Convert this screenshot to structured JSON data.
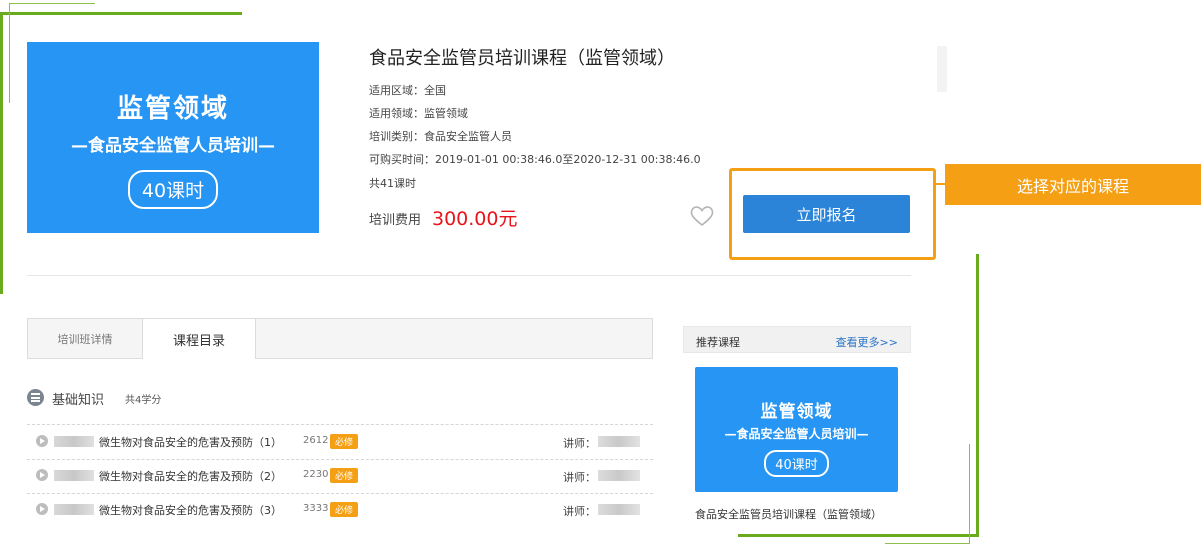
{
  "course": {
    "banner": {
      "title": "监管领域",
      "subtitle": "—食品安全监管人员培训—",
      "hours": "40课时"
    },
    "title": "食品安全监管员培训课程（监管领域）",
    "region": "适用区域：全国",
    "field": "适用领域：监管领域",
    "category": "培训类别：食品安全监管人员",
    "purchase_time": "可购买时间：2019-01-01 00:38:46.0至2020-12-31 00:38:46.0",
    "total_hours": "共41课时",
    "fee_label": "培训费用",
    "fee_value": "300.00元",
    "enroll_label": "立即报名"
  },
  "callout": {
    "text": "选择对应的课程",
    "color": "#f5a014"
  },
  "tabs": [
    {
      "label": "培训班详情",
      "active": false
    },
    {
      "label": "课程目录",
      "active": true
    }
  ],
  "section": {
    "icon": "list-icon",
    "title": "基础知识",
    "credit": "共4学分"
  },
  "lessons": [
    {
      "title": "微生物对食品安全的危害及预防（1）",
      "count": "2612",
      "badge": "必修",
      "lecturer_label": "讲师："
    },
    {
      "title": "微生物对食品安全的危害及预防（2）",
      "count": "2230",
      "badge": "必修",
      "lecturer_label": "讲师："
    },
    {
      "title": "微生物对食品安全的危害及预防（3）",
      "count": "3333",
      "badge": "必修",
      "lecturer_label": "讲师："
    }
  ],
  "recommended": {
    "title": "推荐课程",
    "more": "查看更多>>",
    "banner": {
      "title": "监管领域",
      "subtitle": "—食品安全监管人员培训—",
      "hours": "40课时"
    },
    "caption": "食品安全监管员培训课程（监管领域）"
  },
  "colors": {
    "accent": "#2695f4",
    "button": "#2b84d8",
    "price": "#e8141a",
    "highlight": "#f5a014",
    "decor": "#6aab1e"
  }
}
